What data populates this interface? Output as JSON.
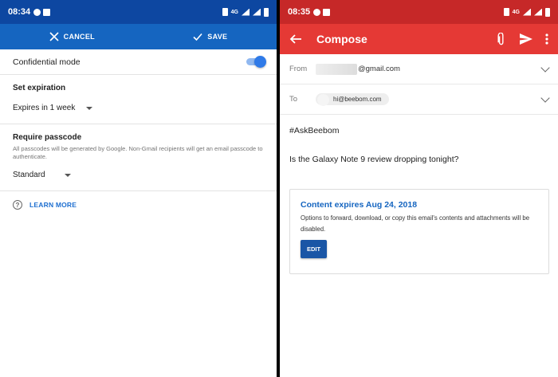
{
  "left": {
    "status_time": "08:34",
    "network": "4G",
    "appbar": {
      "cancel_label": "CANCEL",
      "save_label": "SAVE"
    },
    "confidential_label": "Confidential mode",
    "confidential_on": true,
    "expiration": {
      "title": "Set expiration",
      "value": "Expires in 1 week"
    },
    "passcode": {
      "title": "Require passcode",
      "description": "All passcodes will be generated by Google. Non-Gmail recipients will get an email passcode to authenticate.",
      "value": "Standard"
    },
    "learn_more": "LEARN MORE"
  },
  "right": {
    "status_time": "08:35",
    "network": "4G",
    "appbar": {
      "title": "Compose"
    },
    "from": {
      "label": "From",
      "value": "@gmail.com"
    },
    "to": {
      "label": "To",
      "value": "hi@beebom.com"
    },
    "subject": "#AskBeebom",
    "body": "Is the Galaxy Note 9 review dropping tonight?",
    "card": {
      "title": "Content expires Aug 24, 2018",
      "description": "Options to forward, download, or copy this email's contents and attachments will be disabled.",
      "edit_label": "EDIT"
    }
  },
  "colors": {
    "left_statusbar": "#0d47a1",
    "left_appbar": "#1565c0",
    "right_statusbar": "#c62828",
    "right_appbar": "#e53935",
    "accent_blue": "#1e6fd0"
  },
  "icons": [
    "close-icon",
    "check-icon",
    "help-icon",
    "caret-down-icon",
    "back-arrow-icon",
    "attach-icon",
    "send-icon",
    "more-vert-icon",
    "chevron-down-icon"
  ]
}
